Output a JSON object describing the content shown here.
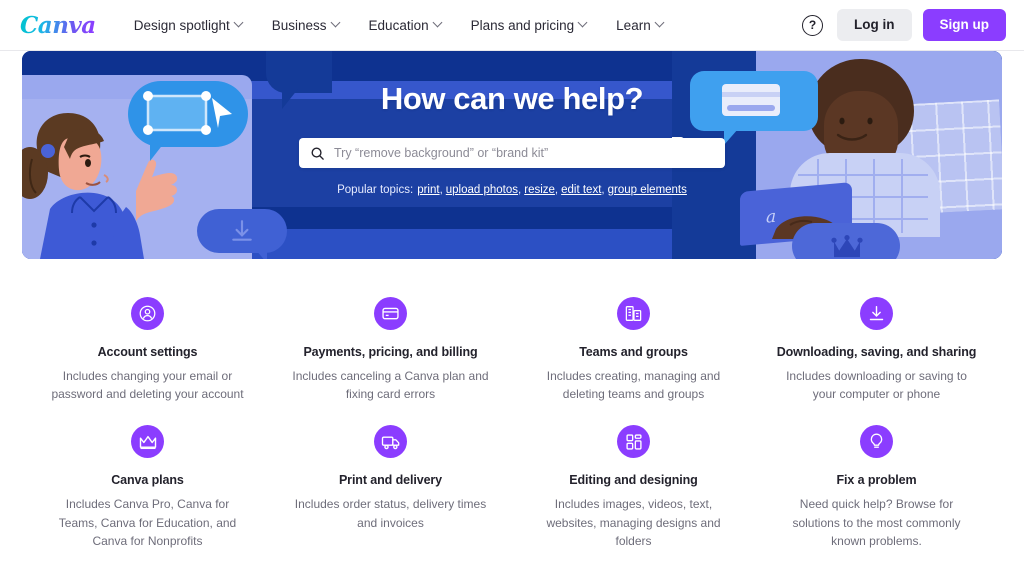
{
  "header": {
    "logo": "Canva",
    "nav": [
      {
        "label": "Design spotlight",
        "icon": "chevron-down-icon"
      },
      {
        "label": "Business",
        "icon": "chevron-down-icon"
      },
      {
        "label": "Education",
        "icon": "chevron-down-icon"
      },
      {
        "label": "Plans and pricing",
        "icon": "chevron-down-icon"
      },
      {
        "label": "Learn",
        "icon": "chevron-down-icon"
      }
    ],
    "help_icon": "question-mark-icon",
    "help_glyph": "?",
    "login_label": "Log in",
    "signup_label": "Sign up",
    "colors": {
      "brand_purple": "#8B3DFF",
      "login_bg": "#ECEDF0"
    }
  },
  "hero": {
    "title": "How can we help?",
    "search": {
      "icon": "search-icon",
      "placeholder": "Try “remove background” or “brand kit”",
      "value": ""
    },
    "popular": {
      "label": "Popular topics:",
      "links": [
        "print",
        "upload photos",
        "resize",
        "edit text",
        "group elements"
      ]
    },
    "colors": {
      "bg_blue": "#1C40A3",
      "band_dark": "#0E3290",
      "bubble_blue": "#2F93E8"
    }
  },
  "cards": [
    {
      "icon": "user-account-icon",
      "title": "Account settings",
      "desc": "Includes changing your email or password and deleting your account"
    },
    {
      "icon": "credit-card-icon",
      "title": "Payments, pricing, and billing",
      "desc": "Includes canceling a Canva plan and fixing card errors"
    },
    {
      "icon": "buildings-icon",
      "title": "Teams and groups",
      "desc": "Includes creating, managing and deleting teams and groups"
    },
    {
      "icon": "download-icon",
      "title": "Downloading, saving, and sharing",
      "desc": "Includes downloading or saving to your computer or phone"
    },
    {
      "icon": "crown-icon",
      "title": "Canva plans",
      "desc": "Includes Canva Pro, Canva for Teams, Canva for Education, and Canva for Nonprofits"
    },
    {
      "icon": "delivery-truck-icon",
      "title": "Print and delivery",
      "desc": "Includes order status, delivery times and invoices"
    },
    {
      "icon": "grid-layout-icon",
      "title": "Editing and designing",
      "desc": "Includes images, videos, text, websites, managing designs and folders"
    },
    {
      "icon": "lightbulb-icon",
      "title": "Fix a problem",
      "desc": "Need quick help? Browse for solutions to the most commonly known problems."
    }
  ]
}
